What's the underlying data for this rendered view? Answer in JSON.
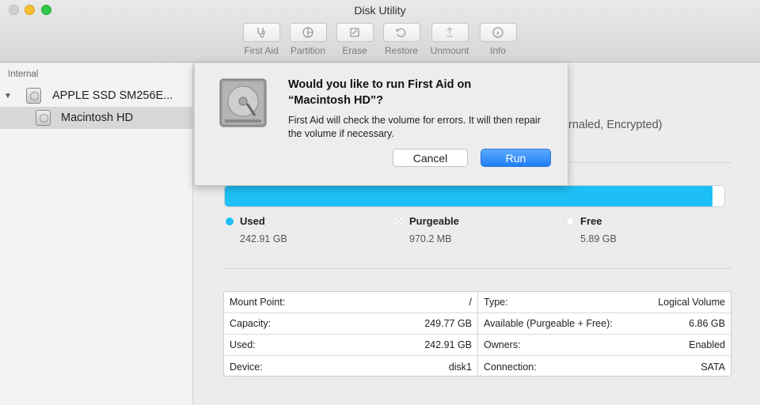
{
  "window": {
    "title": "Disk Utility"
  },
  "toolbar": {
    "items": [
      {
        "label": "First Aid",
        "icon": "stethoscope-icon"
      },
      {
        "label": "Partition",
        "icon": "partition-icon"
      },
      {
        "label": "Erase",
        "icon": "erase-icon"
      },
      {
        "label": "Restore",
        "icon": "restore-icon"
      },
      {
        "label": "Unmount",
        "icon": "unmount-icon"
      },
      {
        "label": "Info",
        "icon": "info-icon"
      }
    ]
  },
  "sidebar": {
    "section": "Internal",
    "disk": "APPLE SSD SM256E...",
    "volume": "Macintosh HD"
  },
  "main": {
    "partial_info": "rnaled, Encrypted)",
    "usage": {
      "used_fraction": 0.976,
      "purgeable_fraction": 0.004,
      "colors": {
        "used": "#1ebff5",
        "purgeable": "#ffffff",
        "free": "#ffffff"
      },
      "legend": [
        {
          "name": "Used",
          "value": "242.91 GB"
        },
        {
          "name": "Purgeable",
          "value": "970.2 MB"
        },
        {
          "name": "Free",
          "value": "5.89 GB"
        }
      ]
    },
    "info_left": [
      {
        "label": "Mount Point:",
        "value": "/"
      },
      {
        "label": "Capacity:",
        "value": "249.77 GB"
      },
      {
        "label": "Used:",
        "value": "242.91 GB"
      },
      {
        "label": "Device:",
        "value": "disk1"
      }
    ],
    "info_right": [
      {
        "label": "Type:",
        "value": "Logical Volume"
      },
      {
        "label": "Available (Purgeable + Free):",
        "value": "6.86 GB"
      },
      {
        "label": "Owners:",
        "value": "Enabled"
      },
      {
        "label": "Connection:",
        "value": "SATA"
      }
    ]
  },
  "dialog": {
    "title_line1": "Would you like to run First Aid on",
    "title_line2": "“Macintosh HD”?",
    "message": "First Aid will check the volume for errors. It will then repair the volume if necessary.",
    "cancel_label": "Cancel",
    "run_label": "Run"
  }
}
